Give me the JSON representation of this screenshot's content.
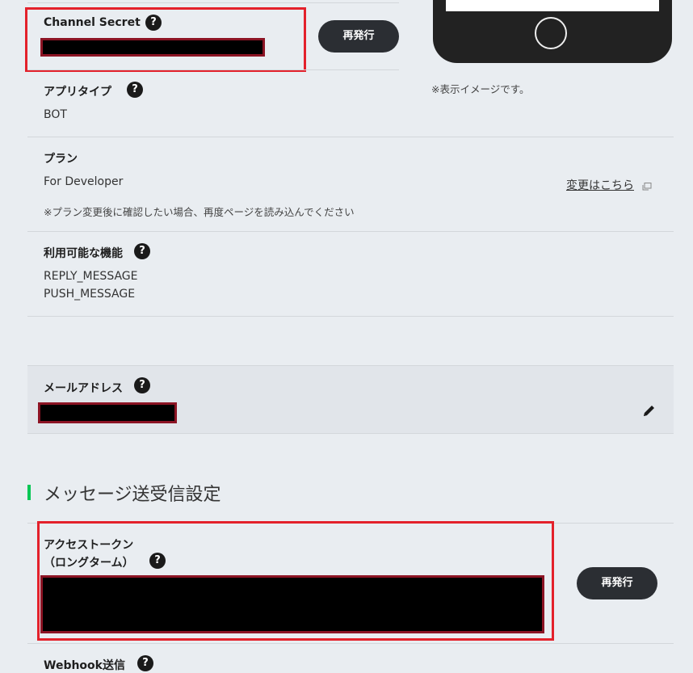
{
  "basic_settings": {
    "channel_secret": {
      "label": "Channel Secret",
      "reissue_label": "再発行"
    },
    "app_type": {
      "label": "アプリタイプ",
      "value": "BOT"
    },
    "plan": {
      "label": "プラン",
      "value": "For Developer",
      "change_link": "変更はこちら",
      "note": "※プラン変更後に確認したい場合、再度ページを読み込んでください"
    },
    "features": {
      "label": "利用可能な機能",
      "items": [
        "REPLY_MESSAGE",
        "PUSH_MESSAGE"
      ]
    },
    "email": {
      "label": "メールアドレス"
    }
  },
  "preview": {
    "caption": "※表示イメージです。"
  },
  "messaging": {
    "section_title": "メッセージ送受信設定",
    "access_token": {
      "label_line1": "アクセストークン",
      "label_line2": "（ロングターム）",
      "reissue_label": "再発行"
    },
    "webhook": {
      "label": "Webhook送信"
    }
  },
  "icons": {
    "help": "?",
    "edit": "pencil-icon",
    "external": "external-window-icon"
  },
  "colors": {
    "highlight": "#e3212b",
    "accent_bar": "#06c755",
    "button": "#2b2e33"
  }
}
